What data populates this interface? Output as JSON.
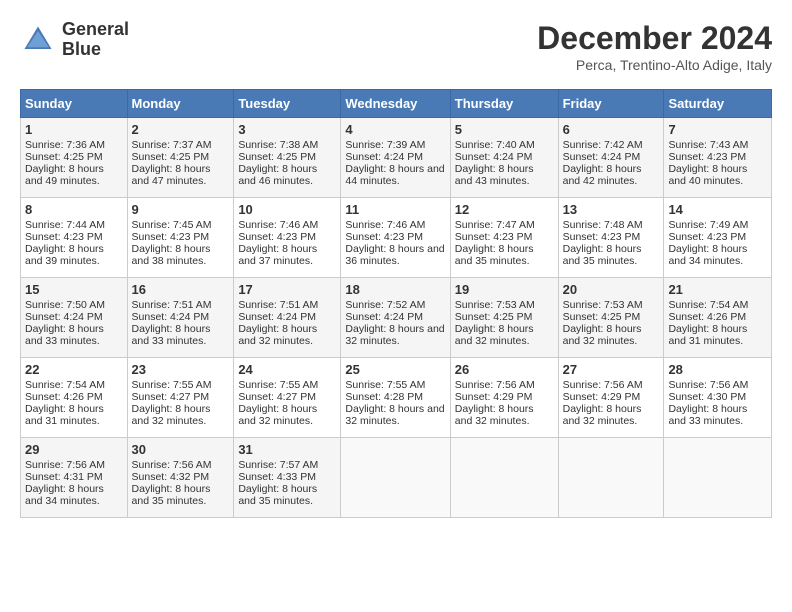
{
  "logo": {
    "text_line1": "General",
    "text_line2": "Blue"
  },
  "header": {
    "month_year": "December 2024",
    "location": "Perca, Trentino-Alto Adige, Italy"
  },
  "weekdays": [
    "Sunday",
    "Monday",
    "Tuesday",
    "Wednesday",
    "Thursday",
    "Friday",
    "Saturday"
  ],
  "weeks": [
    [
      {
        "day": "1",
        "sunrise": "Sunrise: 7:36 AM",
        "sunset": "Sunset: 4:25 PM",
        "daylight": "Daylight: 8 hours and 49 minutes."
      },
      {
        "day": "2",
        "sunrise": "Sunrise: 7:37 AM",
        "sunset": "Sunset: 4:25 PM",
        "daylight": "Daylight: 8 hours and 47 minutes."
      },
      {
        "day": "3",
        "sunrise": "Sunrise: 7:38 AM",
        "sunset": "Sunset: 4:25 PM",
        "daylight": "Daylight: 8 hours and 46 minutes."
      },
      {
        "day": "4",
        "sunrise": "Sunrise: 7:39 AM",
        "sunset": "Sunset: 4:24 PM",
        "daylight": "Daylight: 8 hours and 44 minutes."
      },
      {
        "day": "5",
        "sunrise": "Sunrise: 7:40 AM",
        "sunset": "Sunset: 4:24 PM",
        "daylight": "Daylight: 8 hours and 43 minutes."
      },
      {
        "day": "6",
        "sunrise": "Sunrise: 7:42 AM",
        "sunset": "Sunset: 4:24 PM",
        "daylight": "Daylight: 8 hours and 42 minutes."
      },
      {
        "day": "7",
        "sunrise": "Sunrise: 7:43 AM",
        "sunset": "Sunset: 4:23 PM",
        "daylight": "Daylight: 8 hours and 40 minutes."
      }
    ],
    [
      {
        "day": "8",
        "sunrise": "Sunrise: 7:44 AM",
        "sunset": "Sunset: 4:23 PM",
        "daylight": "Daylight: 8 hours and 39 minutes."
      },
      {
        "day": "9",
        "sunrise": "Sunrise: 7:45 AM",
        "sunset": "Sunset: 4:23 PM",
        "daylight": "Daylight: 8 hours and 38 minutes."
      },
      {
        "day": "10",
        "sunrise": "Sunrise: 7:46 AM",
        "sunset": "Sunset: 4:23 PM",
        "daylight": "Daylight: 8 hours and 37 minutes."
      },
      {
        "day": "11",
        "sunrise": "Sunrise: 7:46 AM",
        "sunset": "Sunset: 4:23 PM",
        "daylight": "Daylight: 8 hours and 36 minutes."
      },
      {
        "day": "12",
        "sunrise": "Sunrise: 7:47 AM",
        "sunset": "Sunset: 4:23 PM",
        "daylight": "Daylight: 8 hours and 35 minutes."
      },
      {
        "day": "13",
        "sunrise": "Sunrise: 7:48 AM",
        "sunset": "Sunset: 4:23 PM",
        "daylight": "Daylight: 8 hours and 35 minutes."
      },
      {
        "day": "14",
        "sunrise": "Sunrise: 7:49 AM",
        "sunset": "Sunset: 4:23 PM",
        "daylight": "Daylight: 8 hours and 34 minutes."
      }
    ],
    [
      {
        "day": "15",
        "sunrise": "Sunrise: 7:50 AM",
        "sunset": "Sunset: 4:24 PM",
        "daylight": "Daylight: 8 hours and 33 minutes."
      },
      {
        "day": "16",
        "sunrise": "Sunrise: 7:51 AM",
        "sunset": "Sunset: 4:24 PM",
        "daylight": "Daylight: 8 hours and 33 minutes."
      },
      {
        "day": "17",
        "sunrise": "Sunrise: 7:51 AM",
        "sunset": "Sunset: 4:24 PM",
        "daylight": "Daylight: 8 hours and 32 minutes."
      },
      {
        "day": "18",
        "sunrise": "Sunrise: 7:52 AM",
        "sunset": "Sunset: 4:24 PM",
        "daylight": "Daylight: 8 hours and 32 minutes."
      },
      {
        "day": "19",
        "sunrise": "Sunrise: 7:53 AM",
        "sunset": "Sunset: 4:25 PM",
        "daylight": "Daylight: 8 hours and 32 minutes."
      },
      {
        "day": "20",
        "sunrise": "Sunrise: 7:53 AM",
        "sunset": "Sunset: 4:25 PM",
        "daylight": "Daylight: 8 hours and 32 minutes."
      },
      {
        "day": "21",
        "sunrise": "Sunrise: 7:54 AM",
        "sunset": "Sunset: 4:26 PM",
        "daylight": "Daylight: 8 hours and 31 minutes."
      }
    ],
    [
      {
        "day": "22",
        "sunrise": "Sunrise: 7:54 AM",
        "sunset": "Sunset: 4:26 PM",
        "daylight": "Daylight: 8 hours and 31 minutes."
      },
      {
        "day": "23",
        "sunrise": "Sunrise: 7:55 AM",
        "sunset": "Sunset: 4:27 PM",
        "daylight": "Daylight: 8 hours and 32 minutes."
      },
      {
        "day": "24",
        "sunrise": "Sunrise: 7:55 AM",
        "sunset": "Sunset: 4:27 PM",
        "daylight": "Daylight: 8 hours and 32 minutes."
      },
      {
        "day": "25",
        "sunrise": "Sunrise: 7:55 AM",
        "sunset": "Sunset: 4:28 PM",
        "daylight": "Daylight: 8 hours and 32 minutes."
      },
      {
        "day": "26",
        "sunrise": "Sunrise: 7:56 AM",
        "sunset": "Sunset: 4:29 PM",
        "daylight": "Daylight: 8 hours and 32 minutes."
      },
      {
        "day": "27",
        "sunrise": "Sunrise: 7:56 AM",
        "sunset": "Sunset: 4:29 PM",
        "daylight": "Daylight: 8 hours and 32 minutes."
      },
      {
        "day": "28",
        "sunrise": "Sunrise: 7:56 AM",
        "sunset": "Sunset: 4:30 PM",
        "daylight": "Daylight: 8 hours and 33 minutes."
      }
    ],
    [
      {
        "day": "29",
        "sunrise": "Sunrise: 7:56 AM",
        "sunset": "Sunset: 4:31 PM",
        "daylight": "Daylight: 8 hours and 34 minutes."
      },
      {
        "day": "30",
        "sunrise": "Sunrise: 7:56 AM",
        "sunset": "Sunset: 4:32 PM",
        "daylight": "Daylight: 8 hours and 35 minutes."
      },
      {
        "day": "31",
        "sunrise": "Sunrise: 7:57 AM",
        "sunset": "Sunset: 4:33 PM",
        "daylight": "Daylight: 8 hours and 35 minutes."
      },
      null,
      null,
      null,
      null
    ]
  ]
}
